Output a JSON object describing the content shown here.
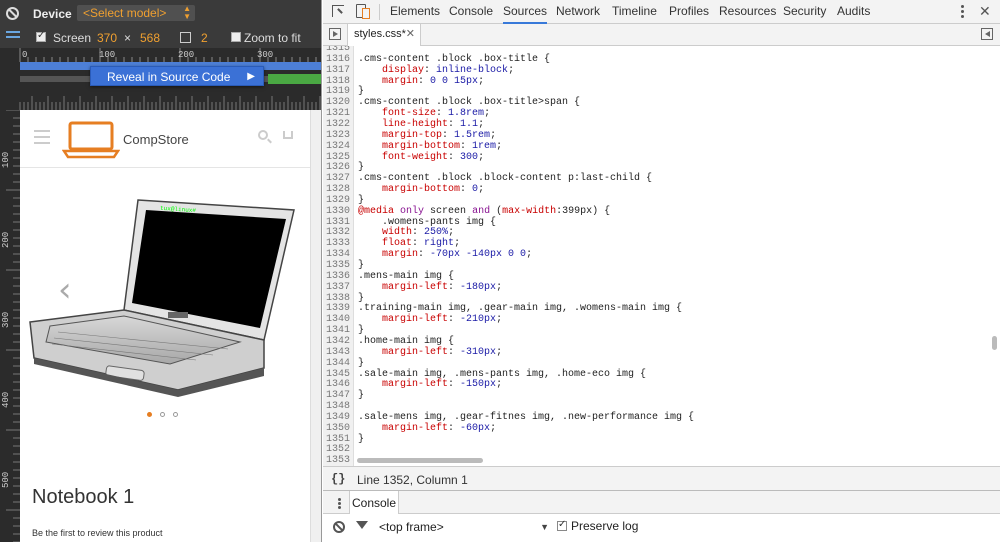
{
  "device_toolbar": {
    "device_label": "Device",
    "model_placeholder": "<Select model>",
    "screen_label": "Screen",
    "width": "370",
    "times": "×",
    "height": "568",
    "scale_value": "2",
    "zoom_label": "Zoom to fit",
    "screen_checked": true,
    "zoom_checked": false
  },
  "ruler": {
    "top_ticks": [
      "0",
      "100",
      "200",
      "300"
    ],
    "left_ticks": [
      "100",
      "200",
      "300",
      "400",
      "500"
    ]
  },
  "context_menu": {
    "label": "Reveal in Source Code"
  },
  "site": {
    "logo_text": "CompStore",
    "laptop_screen_text": "tux@linux#",
    "product_title": "Notebook 1",
    "review_text": "Be the first to review this product",
    "carousel_dots": 3,
    "active_dot": 0,
    "accent": "#e67e22"
  },
  "devtools": {
    "tabs": [
      "Elements",
      "Console",
      "Sources",
      "Network",
      "Timeline",
      "Profiles",
      "Resources",
      "Security",
      "Audits"
    ],
    "active_tab": "Sources",
    "file_tab": "styles.css*",
    "status": "Line 1352, Column 1",
    "drawer_tab": "Console",
    "frame": "<top frame>",
    "preserve_log": "Preserve log"
  },
  "code_lines": [
    {
      "n": "1315",
      "t": ""
    },
    {
      "n": "1316",
      "t": ".cms-content .block .box-title {"
    },
    {
      "n": "1317",
      "t": "    display: inline-block;"
    },
    {
      "n": "1318",
      "t": "    margin: 0 0 15px;"
    },
    {
      "n": "1319",
      "t": "}"
    },
    {
      "n": "1320",
      "t": ".cms-content .block .box-title>span {"
    },
    {
      "n": "1321",
      "t": "    font-size: 1.8rem;"
    },
    {
      "n": "1322",
      "t": "    line-height: 1.1;"
    },
    {
      "n": "1323",
      "t": "    margin-top: 1.5rem;"
    },
    {
      "n": "1324",
      "t": "    margin-bottom: 1rem;"
    },
    {
      "n": "1325",
      "t": "    font-weight: 300;"
    },
    {
      "n": "1326",
      "t": "}"
    },
    {
      "n": "1327",
      "t": ".cms-content .block .block-content p:last-child {"
    },
    {
      "n": "1328",
      "t": "    margin-bottom: 0;"
    },
    {
      "n": "1329",
      "t": "}"
    },
    {
      "n": "1330",
      "t": "@media only screen and (max-width:399px) {"
    },
    {
      "n": "1331",
      "t": "    .womens-pants img {"
    },
    {
      "n": "1332",
      "t": "    width: 250%;"
    },
    {
      "n": "1333",
      "t": "    float: right;"
    },
    {
      "n": "1334",
      "t": "    margin: -70px -140px 0 0;"
    },
    {
      "n": "1335",
      "t": "}"
    },
    {
      "n": "1336",
      "t": ".mens-main img {"
    },
    {
      "n": "1337",
      "t": "    margin-left: -180px;"
    },
    {
      "n": "1338",
      "t": "}"
    },
    {
      "n": "1339",
      "t": ".training-main img, .gear-main img, .womens-main img {"
    },
    {
      "n": "1340",
      "t": "    margin-left: -210px;"
    },
    {
      "n": "1341",
      "t": "}"
    },
    {
      "n": "1342",
      "t": ".home-main img {"
    },
    {
      "n": "1343",
      "t": "    margin-left: -310px;"
    },
    {
      "n": "1344",
      "t": "}"
    },
    {
      "n": "1345",
      "t": ".sale-main img, .mens-pants img, .home-eco img {"
    },
    {
      "n": "1346",
      "t": "    margin-left: -150px;"
    },
    {
      "n": "1347",
      "t": "}"
    },
    {
      "n": "1348",
      "t": ""
    },
    {
      "n": "1349",
      "t": ".sale-mens img, .gear-fitnes img, .new-performance img {"
    },
    {
      "n": "1350",
      "t": "    margin-left: -60px;"
    },
    {
      "n": "1351",
      "t": "}"
    },
    {
      "n": "1352",
      "t": ""
    },
    {
      "n": "1353",
      "t": ""
    }
  ]
}
